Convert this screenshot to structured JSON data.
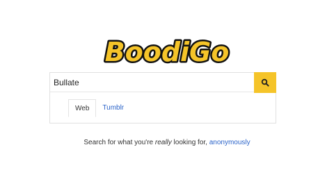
{
  "logo": {
    "text": "BoodiGo",
    "fill_color": "#f5c429",
    "outline_color": "#111111"
  },
  "search": {
    "value": "Bullate",
    "button_icon": "search-icon",
    "button_color": "#f5c429"
  },
  "tabs": [
    {
      "label": "Web",
      "active": true
    },
    {
      "label": "Tumblr",
      "active": false
    }
  ],
  "tagline": {
    "before": "Search for what you're ",
    "emphasis": "really",
    "middle": " looking for, ",
    "link": "anonymously"
  },
  "colors": {
    "link": "#2a63c9",
    "text": "#333333"
  }
}
